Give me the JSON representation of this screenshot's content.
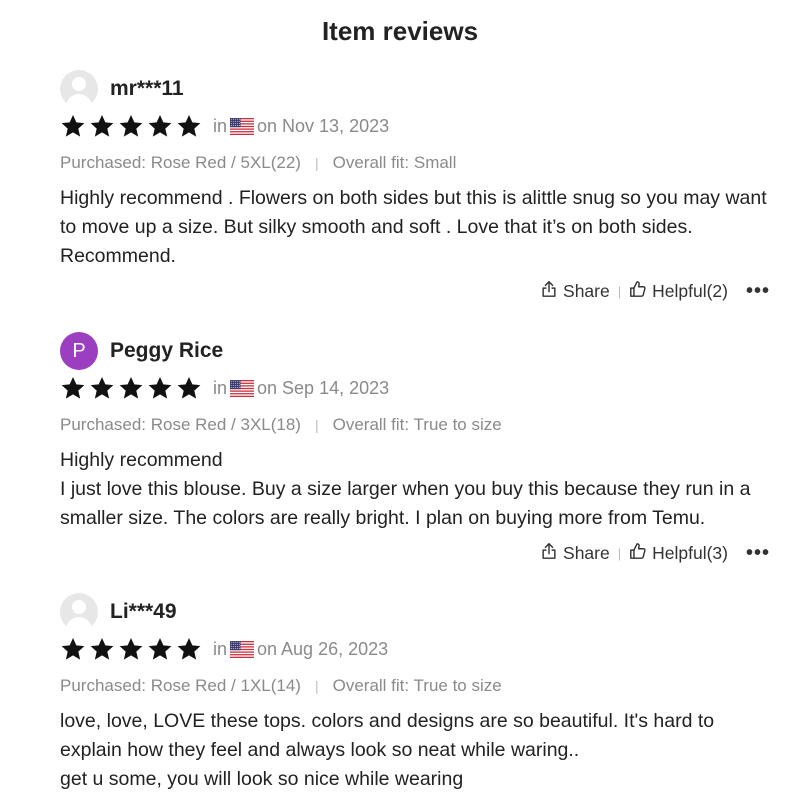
{
  "header": {
    "title": "Item reviews"
  },
  "reviews": [
    {
      "username": "mr***11",
      "avatar": "default-avatar-icon",
      "rating": 5,
      "in_label": "in",
      "date": "on Nov 13, 2023",
      "purchased": "Purchased: Rose Red / 5XL(22)",
      "fit": "Overall fit: Small",
      "text": "Highly recommend . Flowers on both sides but this is alittle snug so you may want to move up a size. But silky smooth and soft . Love that it’s on both sides. Recommend.",
      "share_label": "Share",
      "helpful_label": "Helpful(2)",
      "more_label": "•••"
    },
    {
      "username": "Peggy Rice",
      "avatar_letter": "P",
      "avatar_color": "#9b3fc0",
      "rating": 5,
      "in_label": "in",
      "date": "on Sep 14, 2023",
      "purchased": "Purchased: Rose Red / 3XL(18)",
      "fit": "Overall fit: True to size",
      "text": "Highly recommend\nI just love this blouse. Buy a size larger when you buy this because they run in a smaller size. The colors are really bright. I plan on buying more from Temu.",
      "share_label": "Share",
      "helpful_label": "Helpful(3)",
      "more_label": "•••"
    },
    {
      "username": "Li***49",
      "avatar": "default-avatar-icon",
      "rating": 5,
      "in_label": "in",
      "date": "on Aug 26, 2023",
      "purchased": "Purchased: Rose Red / 1XL(14)",
      "fit": "Overall fit: True to size",
      "text": "love, love, LOVE these tops. colors and designs are so beautiful. It's hard to explain how they feel and always look so neat while waring..\nget u some, you will look so nice while wearing"
    }
  ],
  "separator": "|",
  "colors": {
    "star": "#111111",
    "meta_text": "#8a8a8a",
    "avatar_purple": "#9b3fc0"
  },
  "icons": {
    "star": "star-icon",
    "flag": "us-flag-icon",
    "share": "share-icon",
    "helpful": "thumbs-up-icon",
    "more": "more-icon"
  }
}
